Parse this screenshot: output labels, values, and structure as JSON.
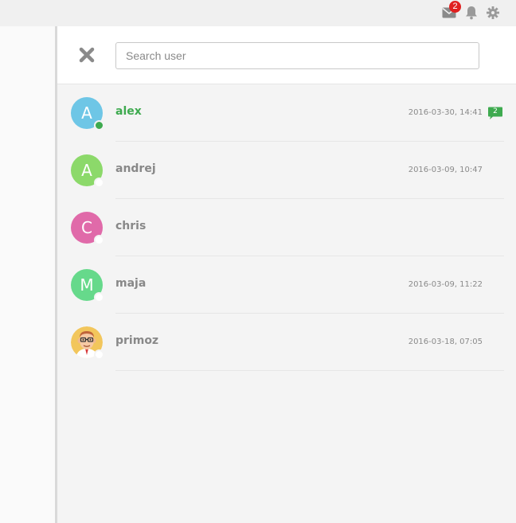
{
  "topbar": {
    "mail_icon": "envelope-icon",
    "mail_badge": "2",
    "bell_icon": "bell-icon",
    "gear_icon": "gear-icon"
  },
  "panel": {
    "close_icon": "close-icon",
    "search": {
      "placeholder": "Search user",
      "value": ""
    }
  },
  "users": [
    {
      "initial": "A",
      "name": "alex",
      "time": "2016-03-30, 14:41",
      "unread": "2",
      "online": true,
      "color": "#6ec6e6"
    },
    {
      "initial": "A",
      "name": "andrej",
      "time": "2016-03-09, 10:47",
      "online": false,
      "color": "#8cd96a"
    },
    {
      "initial": "C",
      "name": "chris",
      "time": "",
      "online": false,
      "color": "#e06aa9"
    },
    {
      "initial": "M",
      "name": "maja",
      "time": "2016-03-09, 11:22",
      "online": false,
      "color": "#66d98b"
    },
    {
      "initial": "",
      "name": "primoz",
      "time": "2016-03-18, 07:05",
      "online": false,
      "color": "#f2c65c",
      "avatar_icon": "cartoon-avatar-icon"
    }
  ],
  "colors": {
    "online": "#3eaa4f",
    "badge_red": "#e02020"
  }
}
